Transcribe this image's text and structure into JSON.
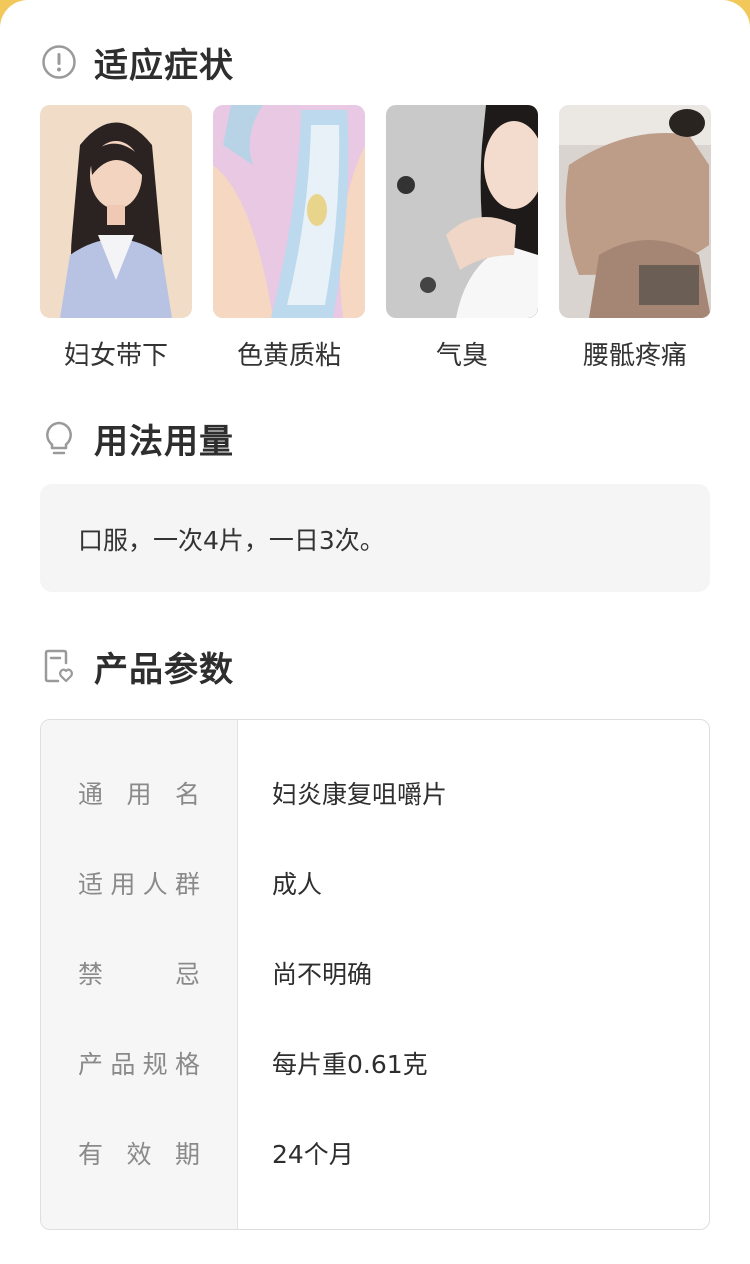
{
  "sections": {
    "symptoms": {
      "title": "适应症状",
      "icon": "exclamation-circle-icon",
      "items": [
        {
          "label": "妇女带下",
          "icon": "woman-portrait-photo"
        },
        {
          "label": "色黄质粘",
          "icon": "pad-illustration"
        },
        {
          "label": "气臭",
          "icon": "woman-covering-nose-photo"
        },
        {
          "label": "腰骶疼痛",
          "icon": "back-pain-photo"
        }
      ]
    },
    "usage": {
      "title": "用法用量",
      "icon": "lightbulb-icon",
      "text": "口服，一次4片，一日3次。"
    },
    "params": {
      "title": "产品参数",
      "icon": "document-heart-icon",
      "rows": [
        {
          "key": [
            "通",
            "用",
            "名"
          ],
          "value": "妇炎康复咀嚼片"
        },
        {
          "key": [
            "适",
            "用",
            "人",
            "群"
          ],
          "value": "成人"
        },
        {
          "key": [
            "禁",
            "忌"
          ],
          "value": "尚不明确"
        },
        {
          "key": [
            "产",
            "品",
            "规",
            "格"
          ],
          "value": "每片重0.61克"
        },
        {
          "key": [
            "有",
            "效",
            "期"
          ],
          "value": "24个月"
        }
      ]
    }
  },
  "colors": {
    "background": "#f3c85a",
    "title": "#2e2e2e",
    "text": "#333333",
    "muted": "#8a8a8a",
    "box": "#f5f5f5"
  }
}
